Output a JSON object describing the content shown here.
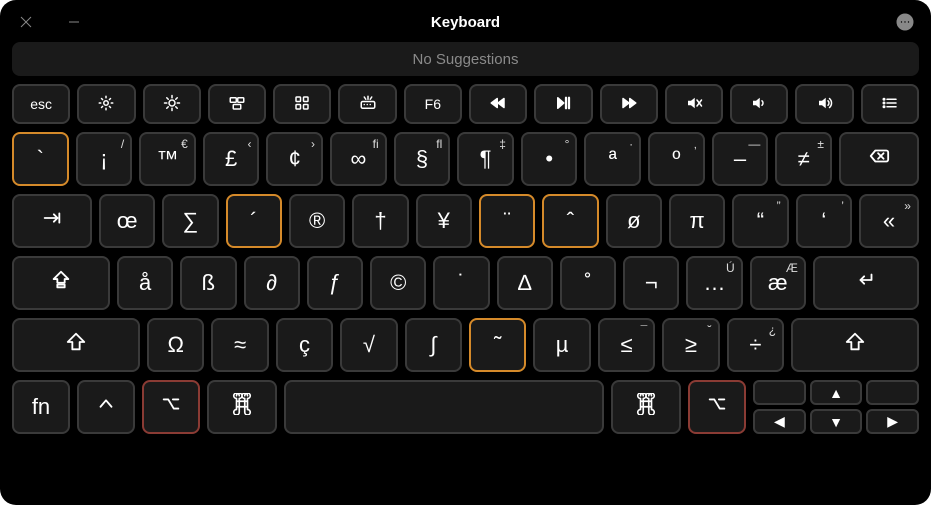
{
  "window": {
    "title": "Keyboard"
  },
  "suggestions": {
    "text": "No Suggestions"
  },
  "function_row": [
    {
      "name": "esc",
      "label": "esc"
    },
    {
      "name": "brightness-down",
      "icon": "brightness-down"
    },
    {
      "name": "brightness-up",
      "icon": "brightness-up"
    },
    {
      "name": "mission-control",
      "icon": "mission-control"
    },
    {
      "name": "launchpad",
      "icon": "launchpad"
    },
    {
      "name": "keyboard-light",
      "icon": "keyboard-light"
    },
    {
      "name": "f6",
      "label": "F6"
    },
    {
      "name": "rewind",
      "icon": "rewind"
    },
    {
      "name": "play-pause",
      "icon": "play-pause"
    },
    {
      "name": "fast-forward",
      "icon": "fast-forward"
    },
    {
      "name": "mute",
      "icon": "mute"
    },
    {
      "name": "volume-down",
      "icon": "volume-down"
    },
    {
      "name": "volume-up",
      "icon": "volume-up"
    },
    {
      "name": "list",
      "icon": "list"
    }
  ],
  "row1": [
    {
      "name": "backtick",
      "label": "`",
      "hl": "orange"
    },
    {
      "name": "exclaim-inv",
      "label": "¡",
      "sup": "/"
    },
    {
      "name": "trademark",
      "label": "™",
      "sup": "€"
    },
    {
      "name": "pound",
      "label": "£",
      "sup": "‹"
    },
    {
      "name": "cent",
      "label": "¢",
      "sup": "›"
    },
    {
      "name": "infinity",
      "label": "∞",
      "sup": "fi"
    },
    {
      "name": "section",
      "label": "§",
      "sup": "fl"
    },
    {
      "name": "pilcrow",
      "label": "¶",
      "sup": "‡"
    },
    {
      "name": "bullet",
      "label": "•",
      "sup": "°"
    },
    {
      "name": "ordfem",
      "label": "ª",
      "sup": "·"
    },
    {
      "name": "ordmasc",
      "label": "º",
      "sup": "‚"
    },
    {
      "name": "endash",
      "label": "–",
      "sup": "—"
    },
    {
      "name": "notequal",
      "label": "≠",
      "sup": "±"
    },
    {
      "name": "backspace",
      "icon": "backspace",
      "wide": 80
    }
  ],
  "row2": [
    {
      "name": "tab",
      "icon": "tab",
      "wide": 80
    },
    {
      "name": "oe",
      "label": "œ"
    },
    {
      "name": "sigma",
      "label": "∑"
    },
    {
      "name": "acute",
      "label": "´",
      "hl": "orange"
    },
    {
      "name": "registered",
      "label": "®"
    },
    {
      "name": "dagger",
      "label": "†"
    },
    {
      "name": "yen",
      "label": "¥"
    },
    {
      "name": "diaeresis",
      "label": "¨",
      "hl": "orange"
    },
    {
      "name": "circumflex",
      "label": "ˆ",
      "hl": "orange"
    },
    {
      "name": "oslash",
      "label": "ø"
    },
    {
      "name": "pi",
      "label": "π"
    },
    {
      "name": "ldquo",
      "label": "“",
      "sup": "”"
    },
    {
      "name": "lsquo",
      "label": "‘",
      "sup": "’"
    },
    {
      "name": "guillemet",
      "label": "«",
      "sup": "»",
      "wide": 60
    }
  ],
  "row3": [
    {
      "name": "capslock",
      "icon": "capslock",
      "wide": 98
    },
    {
      "name": "aring",
      "label": "å"
    },
    {
      "name": "eszett",
      "label": "ß"
    },
    {
      "name": "partial",
      "label": "∂"
    },
    {
      "name": "fhook",
      "label": "ƒ"
    },
    {
      "name": "copyright",
      "label": "©"
    },
    {
      "name": "abovedot",
      "label": "˙"
    },
    {
      "name": "delta",
      "label": "∆"
    },
    {
      "name": "ring",
      "label": "˚"
    },
    {
      "name": "not",
      "label": "¬"
    },
    {
      "name": "ellipsis",
      "label": "…",
      "sup": "Ú"
    },
    {
      "name": "ae",
      "label": "æ",
      "sup": "Æ"
    },
    {
      "name": "return",
      "icon": "return",
      "wide": 106
    }
  ],
  "row4": [
    {
      "name": "shift-left",
      "icon": "shift",
      "wide": 128
    },
    {
      "name": "omega",
      "label": "Ω"
    },
    {
      "name": "approx",
      "label": "≈"
    },
    {
      "name": "ccedilla",
      "label": "ç"
    },
    {
      "name": "radical",
      "label": "√"
    },
    {
      "name": "integral",
      "label": "∫"
    },
    {
      "name": "tilde",
      "label": "˜",
      "hl": "orange"
    },
    {
      "name": "mu",
      "label": "µ"
    },
    {
      "name": "lessequal",
      "label": "≤",
      "sup": "¯"
    },
    {
      "name": "greaterequal",
      "label": "≥",
      "sup": "˘"
    },
    {
      "name": "divide",
      "label": "÷",
      "sup": "¿"
    },
    {
      "name": "shift-right",
      "icon": "shift",
      "wide": 128
    }
  ],
  "row5": [
    {
      "name": "fn",
      "label": "fn",
      "wide": 58
    },
    {
      "name": "control",
      "icon": "control",
      "wide": 58
    },
    {
      "name": "option-left",
      "icon": "option",
      "wide": 58,
      "hl": "red"
    },
    {
      "name": "command-left",
      "icon": "command",
      "wide": 70
    },
    {
      "name": "space",
      "label": "",
      "wide": 320
    },
    {
      "name": "command-right",
      "icon": "command",
      "wide": 70
    },
    {
      "name": "option-right",
      "icon": "option",
      "wide": 58,
      "hl": "red"
    }
  ],
  "arrows": {
    "up": "▲",
    "down": "▼",
    "left": "◀",
    "right": "▶"
  }
}
